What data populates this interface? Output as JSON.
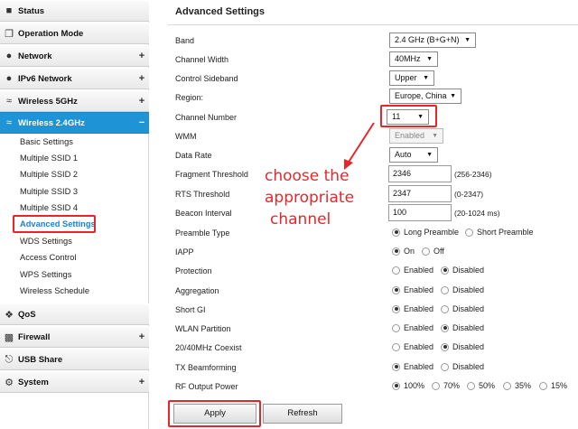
{
  "sidebar": {
    "status": "Status",
    "operation_mode": "Operation Mode",
    "network": "Network",
    "ipv6": "IPv6 Network",
    "wireless5": "Wireless 5GHz",
    "wireless24": "Wireless 2.4GHz",
    "qos": "QoS",
    "firewall": "Firewall",
    "usb_share": "USB Share",
    "system": "System",
    "expand": "+",
    "collapse": "−",
    "sub": {
      "basic": "Basic Settings",
      "ssid1": "Multiple SSID 1",
      "ssid2": "Multiple SSID 2",
      "ssid3": "Multiple SSID 3",
      "ssid4": "Multiple SSID 4",
      "advanced": "Advanced Settings",
      "wds": "WDS Settings",
      "access": "Access Control",
      "wps": "WPS Settings",
      "schedule": "Wireless Schedule"
    }
  },
  "main": {
    "title": "Advanced Settings",
    "band": {
      "label": "Band",
      "value": "2.4 GHz (B+G+N)"
    },
    "channel_width": {
      "label": "Channel Width",
      "value": "40MHz"
    },
    "sideband": {
      "label": "Control Sideband",
      "value": "Upper"
    },
    "region": {
      "label": "Region:",
      "value": "Europe, China"
    },
    "channel_number": {
      "label": "Channel Number",
      "value": "11"
    },
    "wmm": {
      "label": "WMM",
      "value": "Enabled"
    },
    "data_rate": {
      "label": "Data Rate",
      "value": "Auto"
    },
    "fragment": {
      "label": "Fragment Threshold",
      "value": "2346",
      "hint": "(256-2346)"
    },
    "rts": {
      "label": "RTS Threshold",
      "value": "2347",
      "hint": "(0-2347)"
    },
    "beacon": {
      "label": "Beacon Interval",
      "value": "100",
      "hint": "(20-1024 ms)"
    },
    "preamble": {
      "label": "Preamble Type",
      "opt1": "Long Preamble",
      "opt2": "Short Preamble"
    },
    "iapp": {
      "label": "IAPP",
      "opt1": "On",
      "opt2": "Off"
    },
    "protection": {
      "label": "Protection",
      "opt1": "Enabled",
      "opt2": "Disabled"
    },
    "aggregation": {
      "label": "Aggregation",
      "opt1": "Enabled",
      "opt2": "Disabled"
    },
    "short_gi": {
      "label": "Short GI",
      "opt1": "Enabled",
      "opt2": "Disabled"
    },
    "wlan_partition": {
      "label": "WLAN Partition",
      "opt1": "Enabled",
      "opt2": "Disabled"
    },
    "coexist": {
      "label": "20/40MHz Coexist",
      "opt1": "Enabled",
      "opt2": "Disabled"
    },
    "beamforming": {
      "label": "TX Beamforming",
      "opt1": "Enabled",
      "opt2": "Disabled"
    },
    "rf_power": {
      "label": "RF Output Power",
      "o100": "100%",
      "o70": "70%",
      "o50": "50%",
      "o35": "35%",
      "o15": "15%"
    },
    "annotation": {
      "line1": "choose the",
      "line2": "appropriate",
      "line3": "channel"
    },
    "apply": "Apply",
    "refresh": "Refresh"
  },
  "colors": {
    "accent": "#1e93d6",
    "highlight": "#e8262a"
  }
}
